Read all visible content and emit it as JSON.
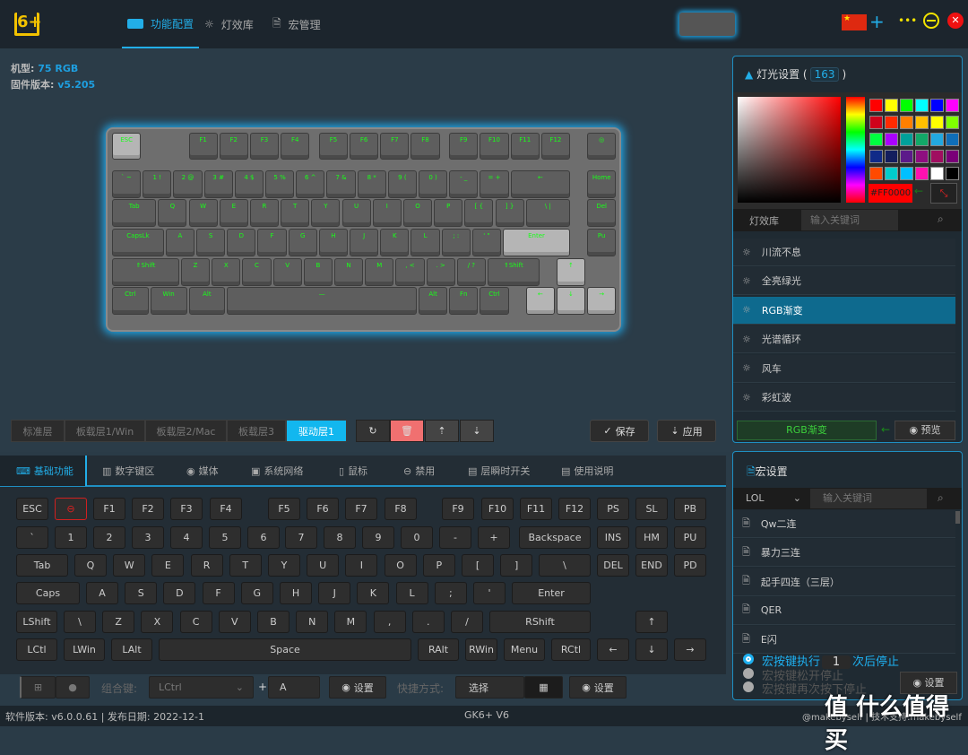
{
  "header": {
    "logo": "6+",
    "tabs": [
      {
        "label": "功能配置",
        "icon": "keyboard-icon"
      },
      {
        "label": "灯效库",
        "icon": "bulb-icon"
      },
      {
        "label": "宏管理",
        "icon": "document-icon"
      }
    ],
    "add": "+",
    "more": "•••"
  },
  "device": {
    "model_label": "机型:",
    "model": "75 RGB",
    "fw_label": "固件版本:",
    "fw": "v5.205"
  },
  "physical_keyboard": {
    "rows": [
      [
        "ESC",
        "F1",
        "F2",
        "F3",
        "F4",
        "F5",
        "F6",
        "F7",
        "F8",
        "F9",
        "F10",
        "F11",
        "F12",
        "◎"
      ],
      [
        "` ~",
        "1 !",
        "2 @",
        "3 #",
        "4 $",
        "5 %",
        "6 ^",
        "7 &",
        "8 *",
        "9 (",
        "0 )",
        "- _",
        "= +",
        "←",
        "Home"
      ],
      [
        "Tab",
        "Q",
        "W",
        "E",
        "R",
        "T",
        "Y",
        "U",
        "I",
        "O",
        "P",
        "[ {",
        "] }",
        "\\ |",
        "Del"
      ],
      [
        "CapsLk",
        "A",
        "S",
        "D",
        "F",
        "G",
        "H",
        "J",
        "K",
        "L",
        "; :",
        "' \"",
        "Enter",
        "Pu"
      ],
      [
        "⇑Shift",
        "Z",
        "X",
        "C",
        "V",
        "B",
        "N",
        "M",
        ", <",
        ". >",
        "/ ?",
        "⇑Shift",
        "↑"
      ],
      [
        "Ctrl",
        "Win",
        "Alt",
        "—",
        "Alt",
        "Fn",
        "Ctrl",
        "←",
        "↓",
        "→"
      ]
    ]
  },
  "layers": [
    "标准层",
    "板载层1/Win",
    "板载层2/Mac",
    "板载层3",
    "驱动层1"
  ],
  "active_layer": 4,
  "actions": {
    "save": "保存",
    "apply": "应用"
  },
  "func_tabs": [
    {
      "label": "基础功能"
    },
    {
      "label": "数字键区"
    },
    {
      "label": "媒体"
    },
    {
      "label": "系统网络"
    },
    {
      "label": "鼠标"
    },
    {
      "label": "禁用"
    },
    {
      "label": "层瞬时开关"
    },
    {
      "label": "使用说明"
    }
  ],
  "virtual_keys": [
    [
      "ESC",
      "⊖",
      "F1",
      "F2",
      "F3",
      "F4",
      "F5",
      "F6",
      "F7",
      "F8",
      "F9",
      "F10",
      "F11",
      "F12",
      "PS",
      "SL",
      "PB"
    ],
    [
      "`",
      "1",
      "2",
      "3",
      "4",
      "5",
      "6",
      "7",
      "8",
      "9",
      "0",
      "-",
      "+",
      "Backspace",
      "INS",
      "HM",
      "PU"
    ],
    [
      "Tab",
      "Q",
      "W",
      "E",
      "R",
      "T",
      "Y",
      "U",
      "I",
      "O",
      "P",
      "[",
      "]",
      "\\",
      "DEL",
      "END",
      "PD"
    ],
    [
      "Caps",
      "A",
      "S",
      "D",
      "F",
      "G",
      "H",
      "J",
      "K",
      "L",
      ";",
      "'",
      "Enter"
    ],
    [
      "LShift",
      "\\",
      "Z",
      "X",
      "C",
      "V",
      "B",
      "N",
      "M",
      ",",
      ".",
      "/",
      "RShift",
      "↑"
    ],
    [
      "LCtl",
      "LWin",
      "LAlt",
      "Space",
      "RAlt",
      "RWin",
      "Menu",
      "RCtl",
      "←",
      "↓",
      "→"
    ]
  ],
  "bottom": {
    "combo_label": "组合键:",
    "combo_value": "LCtrl",
    "plus": "+",
    "key_value": "A",
    "set": "设置",
    "shortcut_label": "快捷方式:",
    "shortcut_value": "选择",
    "set2": "设置"
  },
  "light": {
    "title": "灯光设置 (",
    "count": "163",
    "title_end": ")",
    "hex": "#FF0000",
    "lib_tab": "灯效库",
    "search_placeholder": "输入关键词",
    "swatches": [
      "#ff0000",
      "#ffff00",
      "#00ff00",
      "#00ffff",
      "#0000ff",
      "#ff00ff",
      "#d0021b",
      "#ff2a00",
      "#ff7f00",
      "#ffc000",
      "#ffff00",
      "#80ff00",
      "#00ff40",
      "#aa00ff",
      "#00a09a",
      "#12a868",
      "#22a8e0",
      "#0f6eb8",
      "#102a88",
      "#141e5e",
      "#5c1a8a",
      "#8e0e80",
      "#a00e60",
      "#7a0078",
      "#ff4a00",
      "#00cccc",
      "#00c0ff",
      "#ff10b0",
      "#ffffff",
      "#000000"
    ],
    "effects": [
      "川流不息",
      "全亮绿光",
      "RGB渐变",
      "光谱循环",
      "风车",
      "彩虹波"
    ],
    "active_effect": 2,
    "selected": "RGB渐变",
    "preview": "预览"
  },
  "macro": {
    "title": "宏设置",
    "group": "LOL",
    "search_placeholder": "输入关键词",
    "items": [
      "Qw二连",
      "暴力三连",
      "起手四连（三层）",
      "QER",
      "E闪"
    ],
    "opt1_a": "宏按键执行",
    "opt1_count": "1",
    "opt1_b": "次后停止",
    "opt2": "宏按键松开停止",
    "opt3": "宏按键再次按下停止",
    "set": "设置"
  },
  "status": {
    "left": "软件版本: v6.0.0.61 | 发布日期: 2022-12-1",
    "center": "GK6+ V6",
    "right": "@makebyself | 技术支持:makebyself"
  },
  "watermark": "值 什么值得买"
}
